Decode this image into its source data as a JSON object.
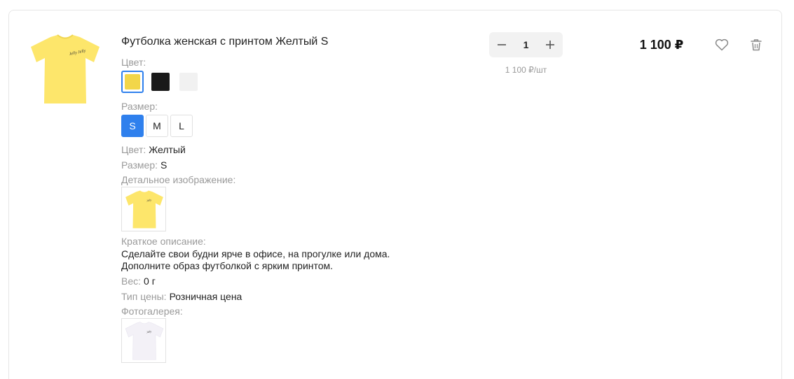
{
  "product": {
    "title": "Футболка женская с принтом Желтый S"
  },
  "options": {
    "color_label": "Цвет:",
    "colors": [
      {
        "name": "yellow",
        "hex": "#f2d64a",
        "selected": true
      },
      {
        "name": "black",
        "hex": "#1a1a1a",
        "selected": false
      },
      {
        "name": "white",
        "hex": "#f1f1f1",
        "selected": false
      }
    ],
    "size_label": "Размер:",
    "sizes": [
      {
        "label": "S",
        "selected": true
      },
      {
        "label": "M",
        "selected": false
      },
      {
        "label": "L",
        "selected": false
      }
    ]
  },
  "props": {
    "color_label": "Цвет:",
    "color_value": "Желтый",
    "size_label": "Размер:",
    "size_value": "S",
    "detail_image_label": "Детальное изображение:",
    "short_desc_label": "Краткое описание:",
    "short_desc_line1": "Сделайте свои будни ярче в офисе, на прогулке или дома.",
    "short_desc_line2": "Дополните образ футболкой с ярким принтом.",
    "weight_label": "Вес:",
    "weight_value": "0 г",
    "price_type_label": "Тип цены:",
    "price_type_value": "Розничная цена",
    "gallery_label": "Фотогалерея:"
  },
  "quantity": {
    "value": "1",
    "unit_price": "1 100 ₽/шт"
  },
  "total": "1 100 ₽",
  "colors": {
    "accent": "#2f80ed",
    "tshirt_yellow": "#fde66b",
    "tshirt_white": "#f3f1f7"
  },
  "icons": {
    "favorite": "heart-icon",
    "delete": "trash-icon",
    "decrease": "minus-icon",
    "increase": "plus-icon"
  }
}
